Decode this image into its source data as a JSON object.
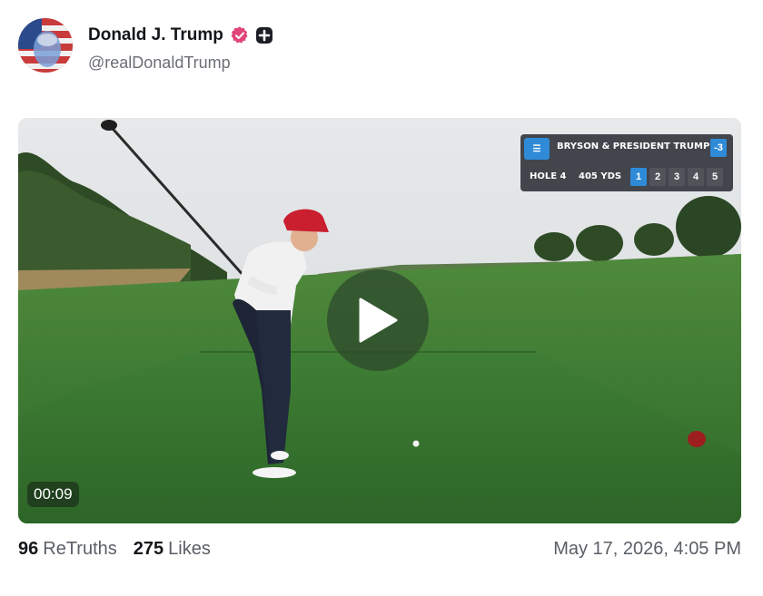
{
  "author": {
    "name": "Donald J. Trump",
    "handle": "@realDonaldTrump",
    "verified_icon": "verified-badge-icon",
    "extra_icon": "plus-badge-icon"
  },
  "video": {
    "duration": "00:09",
    "play_icon": "play-icon",
    "scorebug": {
      "team": "BRYSON & PRESIDENT TRUMP",
      "score": "-3",
      "hole_label": "HOLE 4",
      "yardage": "405 YDS",
      "holes": [
        "1",
        "2",
        "3",
        "4",
        "5"
      ]
    }
  },
  "stats": {
    "retruths_count": "96",
    "retruths_label": "ReTruths",
    "likes_count": "275",
    "likes_label": "Likes"
  },
  "timestamp": "May 17, 2026, 4:05 PM",
  "colors": {
    "verified": "#e0457b",
    "accent_blue": "#2f8bd8",
    "text_primary": "#14171a",
    "text_secondary": "#5a5f66"
  }
}
